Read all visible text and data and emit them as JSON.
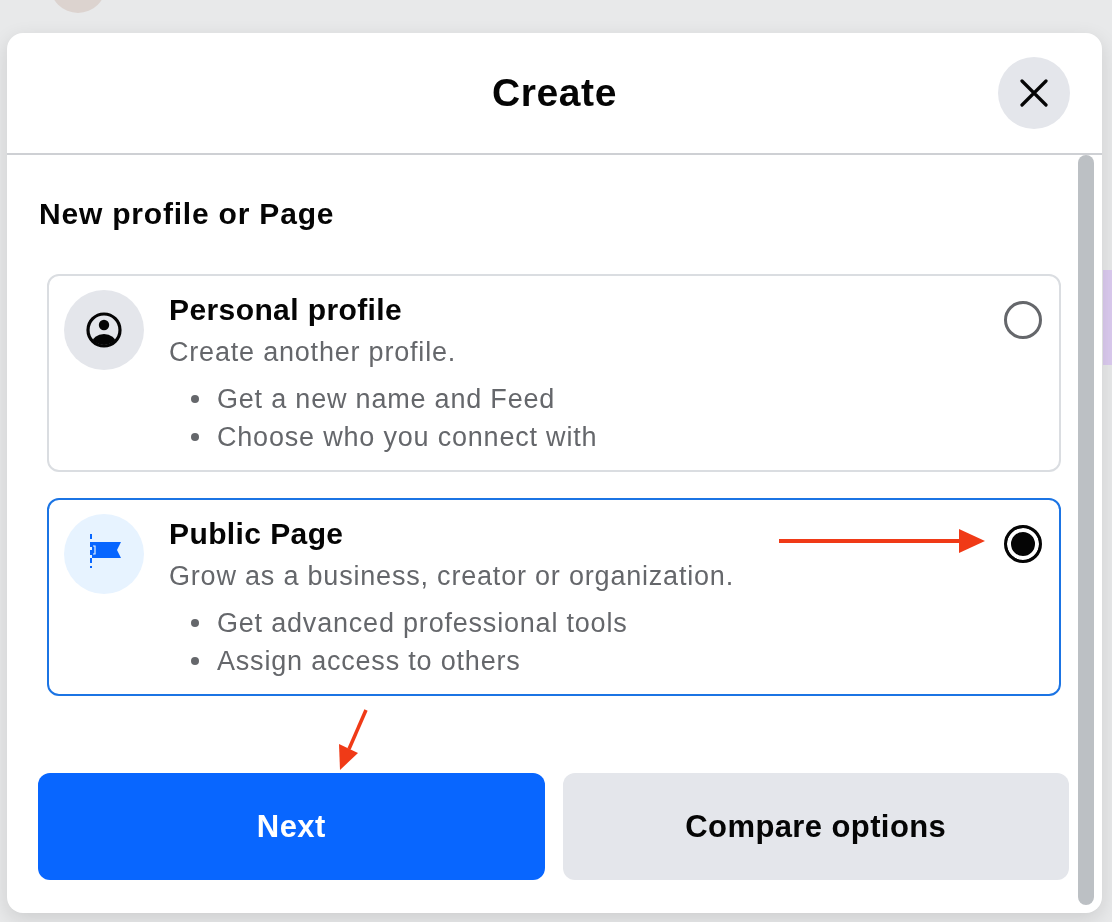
{
  "dialog": {
    "title": "Create"
  },
  "section_title": "New profile or Page",
  "options": [
    {
      "kind": "profile",
      "title": "Personal profile",
      "description": "Create another profile.",
      "bullets": [
        "Get a new name and Feed",
        "Choose who you connect with"
      ],
      "selected": false
    },
    {
      "kind": "page",
      "title": "Public Page",
      "description": "Grow as a business, creator or organization.",
      "bullets": [
        "Get advanced professional tools",
        "Assign access to others"
      ],
      "selected": true
    }
  ],
  "buttons": [
    {
      "kind": "primary",
      "label": "Next"
    },
    {
      "kind": "secondary",
      "label": "Compare options"
    }
  ]
}
